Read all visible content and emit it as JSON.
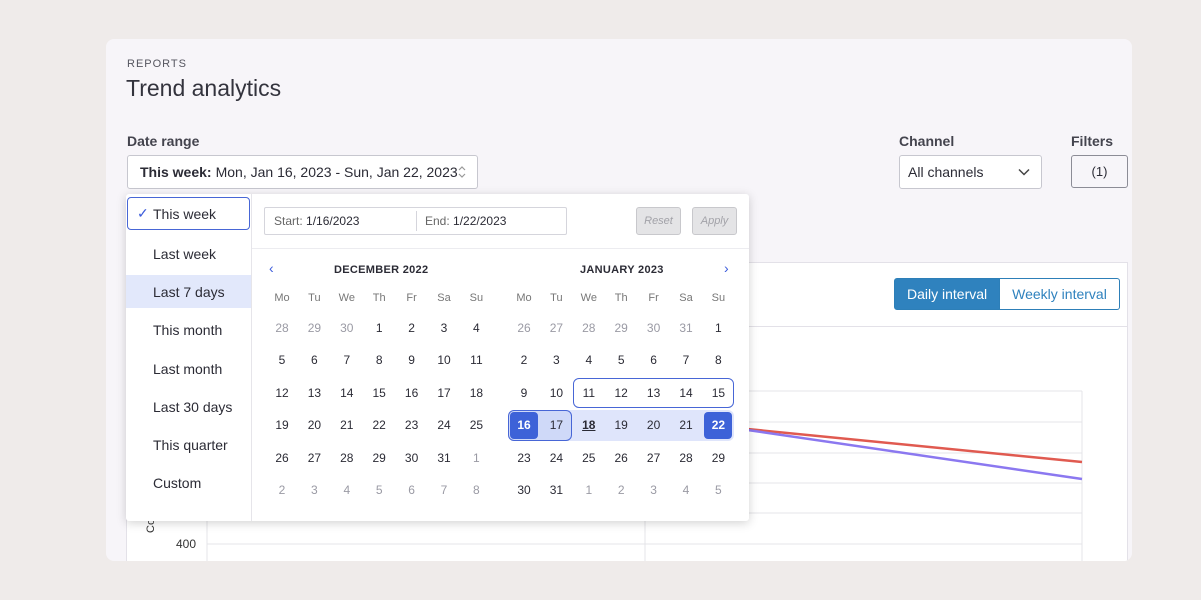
{
  "header": {
    "eyebrow": "REPORTS",
    "title": "Trend analytics"
  },
  "date_range": {
    "label": "Date range",
    "selected_prefix": "This week:",
    "selected_value": "Mon, Jan 16, 2023 - Sun, Jan 22, 2023"
  },
  "channel": {
    "label": "Channel",
    "value": "All channels"
  },
  "filters": {
    "label": "Filters",
    "value": "(1)"
  },
  "interval": {
    "daily": "Daily interval",
    "weekly": "Weekly interval"
  },
  "chart": {
    "y_tick": "400",
    "y_label": "Cont"
  },
  "popup": {
    "presets": [
      "This week",
      "Last week",
      "Last 7 days",
      "This month",
      "Last month",
      "Last 30 days",
      "This quarter",
      "Custom"
    ],
    "start_label": "Start:",
    "start_value": "1/16/2023",
    "end_label": "End:",
    "end_value": "1/22/2023",
    "reset": "Reset",
    "apply": "Apply",
    "weekdays": [
      "Mo",
      "Tu",
      "We",
      "Th",
      "Fr",
      "Sa",
      "Su"
    ],
    "months": [
      {
        "title": "DECEMBER 2022",
        "days": [
          [
            "28",
            "29",
            "30",
            "1",
            "2",
            "3",
            "4"
          ],
          [
            "5",
            "6",
            "7",
            "8",
            "9",
            "10",
            "11"
          ],
          [
            "12",
            "13",
            "14",
            "15",
            "16",
            "17",
            "18"
          ],
          [
            "19",
            "20",
            "21",
            "22",
            "23",
            "24",
            "25"
          ],
          [
            "26",
            "27",
            "28",
            "29",
            "30",
            "31",
            "1"
          ],
          [
            "2",
            "3",
            "4",
            "5",
            "6",
            "7",
            "8"
          ]
        ]
      },
      {
        "title": "JANUARY 2023",
        "days": [
          [
            "26",
            "27",
            "28",
            "29",
            "30",
            "31",
            "1"
          ],
          [
            "2",
            "3",
            "4",
            "5",
            "6",
            "7",
            "8"
          ],
          [
            "9",
            "10",
            "11",
            "12",
            "13",
            "14",
            "15"
          ],
          [
            "16",
            "17",
            "18",
            "19",
            "20",
            "21",
            "22"
          ],
          [
            "23",
            "24",
            "25",
            "26",
            "27",
            "28",
            "29"
          ],
          [
            "30",
            "31",
            "1",
            "2",
            "3",
            "4",
            "5"
          ]
        ]
      }
    ]
  },
  "colors": {
    "accent": "#3b5bdb",
    "interval_blue": "#2f82be",
    "line_red": "#e05a50",
    "line_purple": "#8b78f0"
  }
}
